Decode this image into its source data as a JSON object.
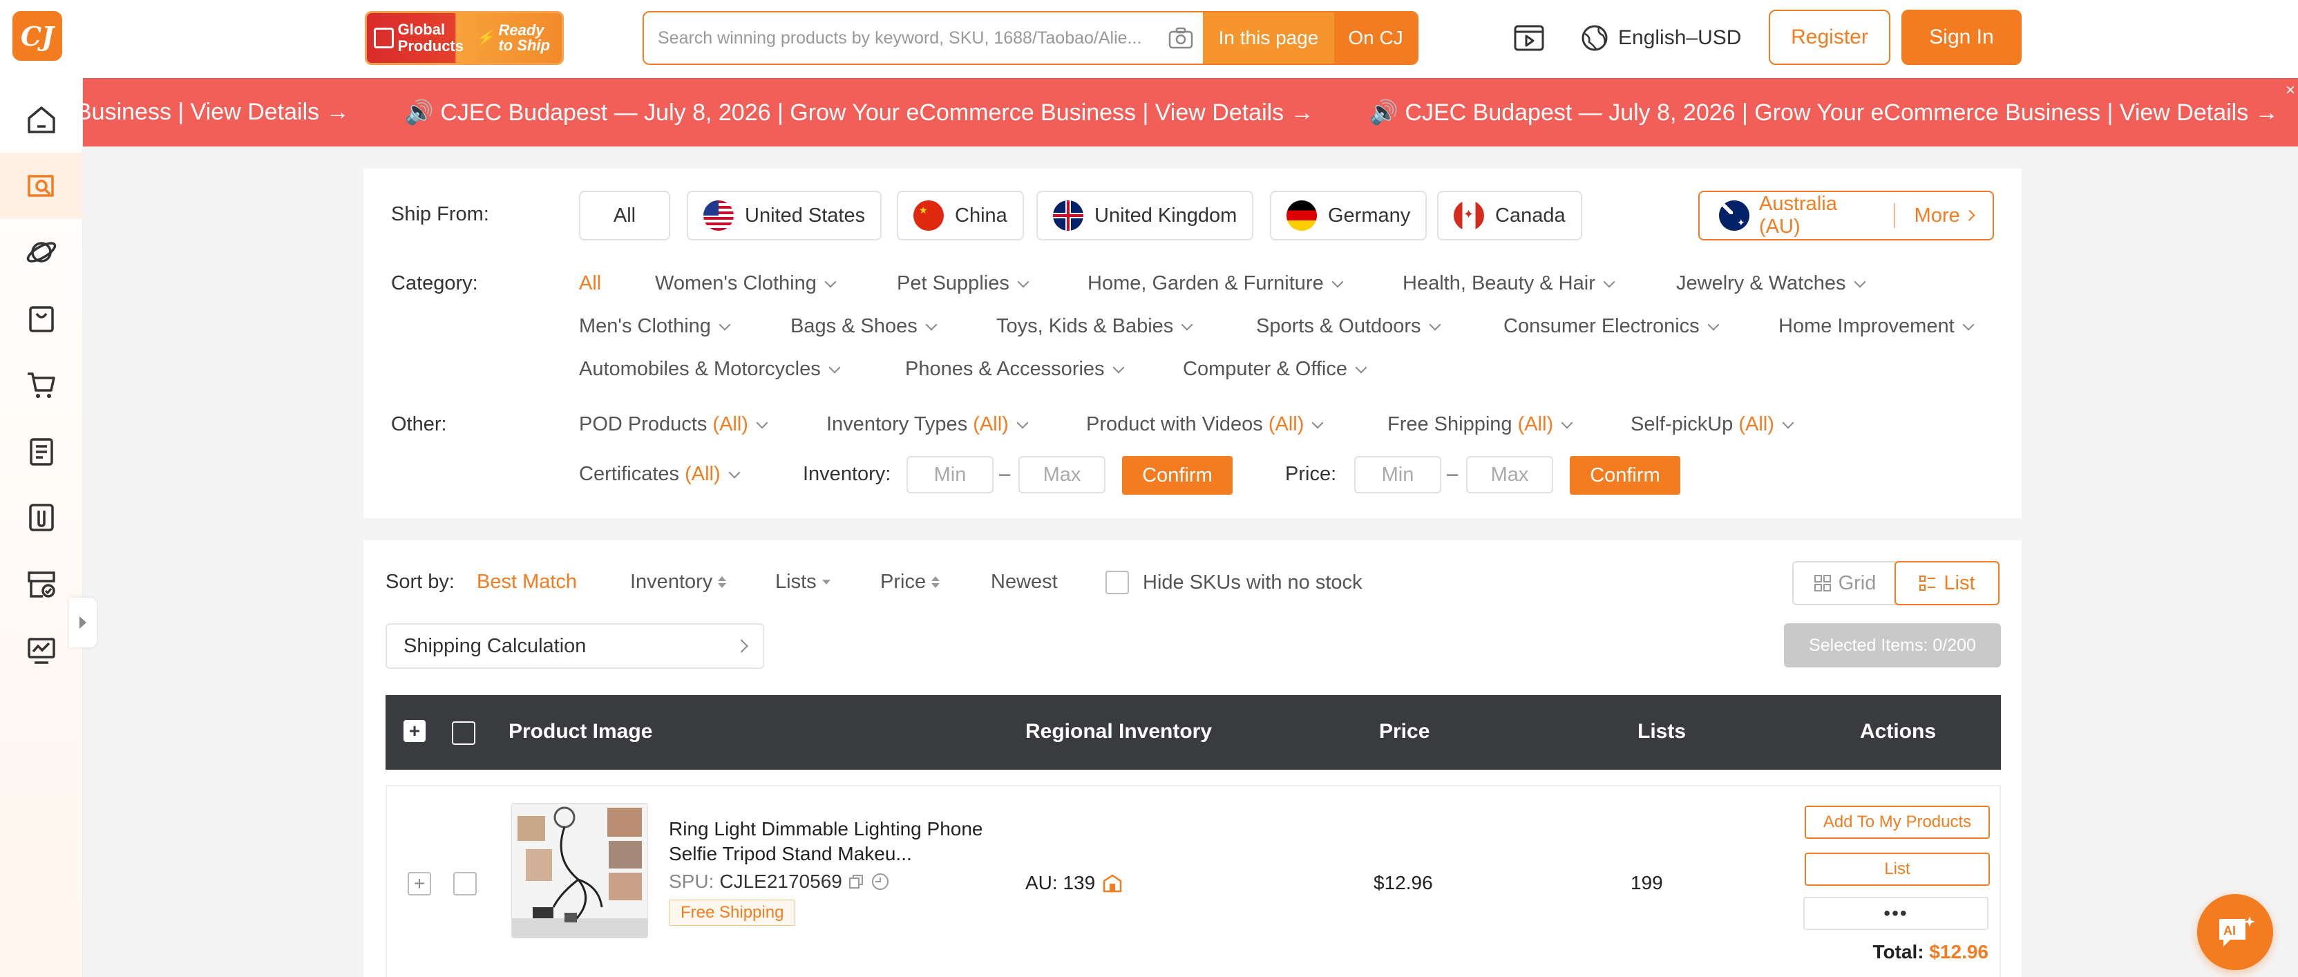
{
  "header": {
    "logo_text": "CJ",
    "banner": {
      "left_line1": "Global",
      "left_line2": "Products",
      "right_line1": "Ready",
      "right_line2": "to Ship"
    },
    "search": {
      "placeholder": "Search winning products by keyword, SKU, 1688/Taobao/Alie...",
      "btn_page": "In this page",
      "btn_cj": "On CJ"
    },
    "language": "English–USD",
    "register": "Register",
    "signin": "Sign In"
  },
  "marquee": {
    "items": [
      "Business | View Details →",
      "🔊 CJEC Budapest — July 8, 2026 | Grow Your eCommerce Business | View Details →",
      "🔊 CJEC Budapest — July 8, 2026 | Grow Your eCommerce Business | View Details →"
    ],
    "close": "×"
  },
  "filters": {
    "ship_from_label": "Ship From:",
    "ship_from": [
      "All",
      "United States",
      "China",
      "United Kingdom",
      "Germany",
      "Canada"
    ],
    "ship_more": {
      "selected": "Australia (AU)",
      "more": "More"
    },
    "category_label": "Category:",
    "categories_row1": [
      "All",
      "Women's Clothing",
      "Pet Supplies",
      "Home, Garden & Furniture",
      "Health, Beauty & Hair",
      "Jewelry & Watches"
    ],
    "categories_row2": [
      "Men's Clothing",
      "Bags & Shoes",
      "Toys, Kids & Babies",
      "Sports & Outdoors",
      "Consumer Electronics",
      "Home Improvement"
    ],
    "categories_row3": [
      "Automobiles & Motorcycles",
      "Phones & Accessories",
      "Computer & Office"
    ],
    "other_label": "Other:",
    "other": [
      {
        "label": "POD Products",
        "value": "(All)"
      },
      {
        "label": "Inventory Types",
        "value": "(All)"
      },
      {
        "label": "Product with Videos",
        "value": "(All)"
      },
      {
        "label": "Free Shipping",
        "value": "(All)"
      },
      {
        "label": "Self-pickUp",
        "value": "(All)"
      }
    ],
    "certificates": {
      "label": "Certificates",
      "value": "(All)"
    },
    "inventory_label": "Inventory:",
    "price_label": "Price:",
    "min": "Min",
    "max": "Max",
    "dash": "–",
    "confirm": "Confirm"
  },
  "results": {
    "sort_label": "Sort by:",
    "sort": [
      "Best Match",
      "Inventory",
      "Lists",
      "Price",
      "Newest"
    ],
    "hide_skus": "Hide SKUs with no stock",
    "view_grid": "Grid",
    "view_list": "List",
    "shipping_calc": "Shipping Calculation",
    "selected_items": "Selected Items: 0/200",
    "columns": [
      "Product Image",
      "Regional Inventory",
      "Price",
      "Lists",
      "Actions"
    ],
    "rows": [
      {
        "title": "Ring Light Dimmable Lighting Phone Selfie Tripod Stand Makeu...",
        "spu_label": "SPU:",
        "spu": "CJLE2170569",
        "badge": "Free Shipping",
        "inventory": "AU: 139",
        "price": "$12.96",
        "lists": "199",
        "add_btn": "Add To My Products",
        "list_btn": "List",
        "more_btn": "•••",
        "total_label": "Total:",
        "total": "$12.96"
      }
    ]
  },
  "colors": {
    "accent": "#f47c20",
    "marquee": "#f25e58",
    "table_header": "#3a3b3f"
  }
}
